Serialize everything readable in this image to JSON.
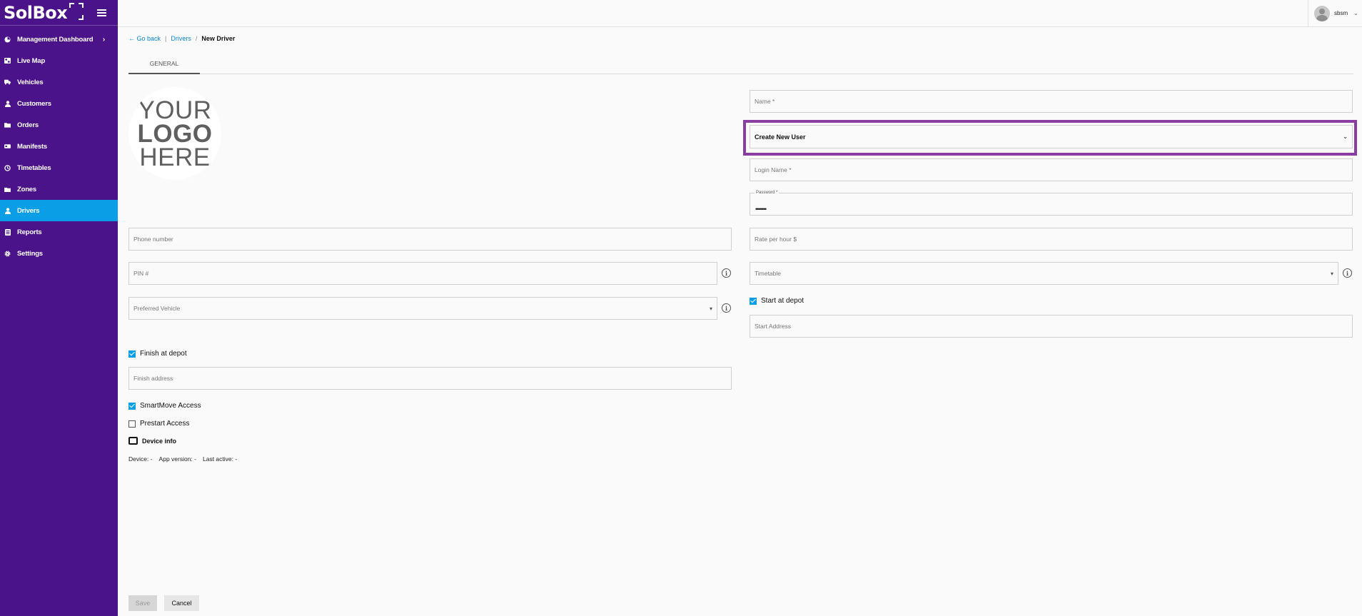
{
  "brand": {
    "name": "SolBox"
  },
  "sidebar": {
    "items": [
      {
        "label": "Management Dashboard",
        "icon": "dashboard-icon"
      },
      {
        "label": "Live Map",
        "icon": "map-icon"
      },
      {
        "label": "Vehicles",
        "icon": "truck-icon"
      },
      {
        "label": "Customers",
        "icon": "person-icon"
      },
      {
        "label": "Orders",
        "icon": "folder-icon"
      },
      {
        "label": "Manifests",
        "icon": "manifest-icon"
      },
      {
        "label": "Timetables",
        "icon": "clock-icon"
      },
      {
        "label": "Zones",
        "icon": "zone-icon"
      },
      {
        "label": "Drivers",
        "icon": "driver-icon"
      },
      {
        "label": "Reports",
        "icon": "report-icon"
      },
      {
        "label": "Settings",
        "icon": "gear-icon"
      }
    ],
    "active": "Drivers",
    "accent": "#0a9ee6",
    "background": "#4a138a"
  },
  "user": {
    "name": "sbsm"
  },
  "breadcrumb": {
    "back": "Go back",
    "parent": "Drivers",
    "current": "New Driver"
  },
  "tabs": [
    {
      "label": "GENERAL"
    }
  ],
  "logo_placeholder": {
    "line1": "YOUR",
    "line2": "LOGO",
    "line3": "HERE"
  },
  "form": {
    "name_placeholder": "Name *",
    "user_select_value": "Create New User",
    "login_name_placeholder": "Login Name *",
    "password_label": "Password *",
    "password_value": "•••••••",
    "phone_placeholder": "Phone number",
    "rate_placeholder": "Rate per hour $",
    "pin_placeholder": "PIN #",
    "timetable_placeholder": "Timetable",
    "preferred_vehicle_placeholder": "Preferred Vehicle",
    "start_at_depot_label": "Start at depot",
    "start_at_depot_checked": true,
    "start_address_placeholder": "Start Address",
    "finish_at_depot_label": "Finish at depot",
    "finish_at_depot_checked": true,
    "finish_address_placeholder": "Finish address",
    "smartmove_label": "SmartMove Access",
    "smartmove_checked": true,
    "prestart_label": "Prestart Access",
    "prestart_checked": false,
    "device_info_label": "Device info"
  },
  "device_info": {
    "device": "Device: -",
    "app_version": "App version: -",
    "last_active": "Last active: -"
  },
  "actions": {
    "save": "Save",
    "cancel": "Cancel"
  },
  "highlight_color": "#8a3ea2"
}
